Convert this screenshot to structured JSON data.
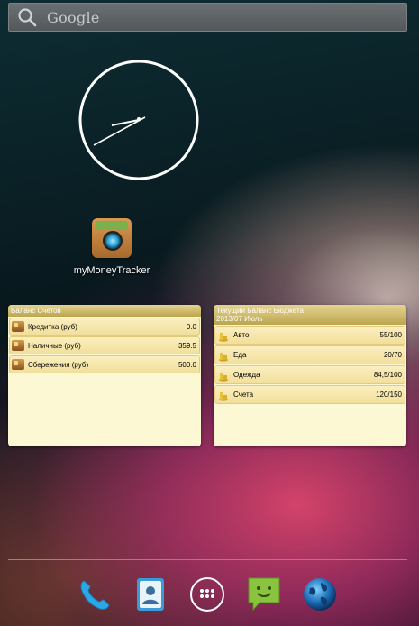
{
  "search": {
    "placeholder": "Google"
  },
  "shortcut": {
    "label": "myMoneyTracker"
  },
  "accounts_widget": {
    "title": "Баланс Счетов",
    "rows": [
      {
        "label": "Кредитка (руб)",
        "value": "0.0"
      },
      {
        "label": "Наличные (руб)",
        "value": "359.5"
      },
      {
        "label": "Сбережения (руб)",
        "value": "500.0"
      }
    ]
  },
  "budget_widget": {
    "title": "Текущий Баланс Бюджета",
    "period": "2013/07 Июль",
    "rows": [
      {
        "label": "Авто",
        "value": "55/100"
      },
      {
        "label": "Еда",
        "value": "20/70"
      },
      {
        "label": "Одежда",
        "value": "84,5/100"
      },
      {
        "label": "Счета",
        "value": "120/150"
      }
    ]
  },
  "dock": {
    "items": [
      "phone-icon",
      "contacts-icon",
      "app-drawer-icon",
      "messaging-icon",
      "browser-icon"
    ]
  },
  "colors": {
    "widget_background": "#fdf8d4",
    "widget_header": "#c7b15c",
    "search_bar": "#5e6366"
  }
}
